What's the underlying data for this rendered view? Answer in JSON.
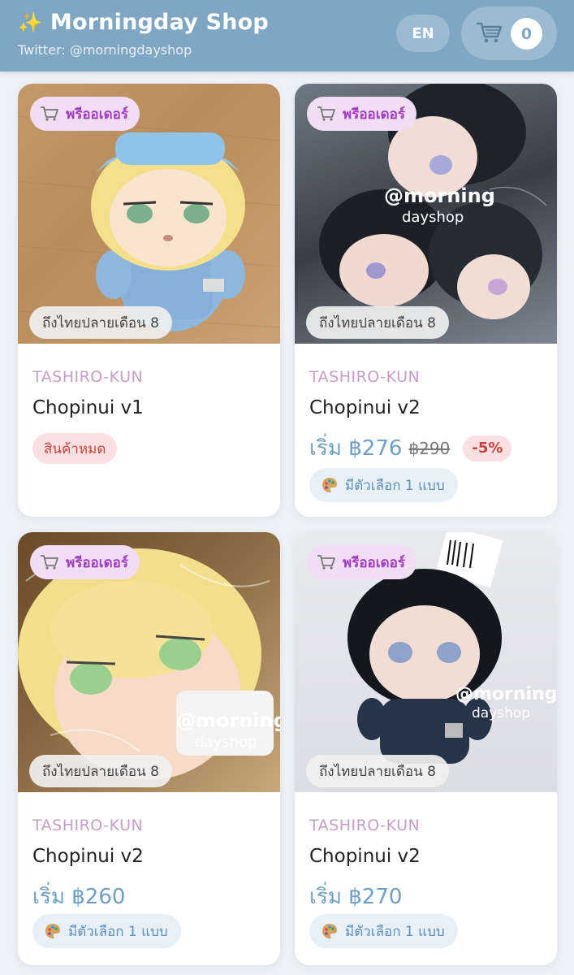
{
  "header": {
    "sparkle_icon": "✨",
    "shop_name": "Morningday Shop",
    "twitter": "Twitter: @morningdayshop",
    "lang_label": "EN",
    "cart_count": "0",
    "bg_color": "#7fa7c4"
  },
  "products": [
    {
      "badge": "พรีออเดอร์",
      "arrival": "ถึงไทยปลายเดือน 8",
      "brand": "TASHIRO-KUN",
      "name": "Chopinui v1",
      "status": "สินค้าหมด"
    },
    {
      "badge": "พรีออเดอร์",
      "arrival": "ถึงไทยปลายเดือน 8",
      "brand": "TASHIRO-KUN",
      "name": "Chopinui v2",
      "price": "เริ่ม ฿276",
      "old_price": "฿290",
      "discount": "-5%",
      "options": "มีตัวเลือก 1 แบบ"
    },
    {
      "badge": "พรีออเดอร์",
      "arrival": "ถึงไทยปลายเดือน 8",
      "brand": "TASHIRO-KUN",
      "name": "Chopinui v2",
      "price": "เริ่ม ฿260",
      "options": "มีตัวเลือก 1 แบบ"
    },
    {
      "badge": "พรีออเดอร์",
      "arrival": "ถึงไทยปลายเดือน 8",
      "brand": "TASHIRO-KUN",
      "name": "Chopinui v2",
      "price": "เริ่ม ฿270",
      "options": "มีตัวเลือก 1 แบบ"
    }
  ],
  "watermark": {
    "line1": "@morning",
    "line2": "dayshop"
  }
}
